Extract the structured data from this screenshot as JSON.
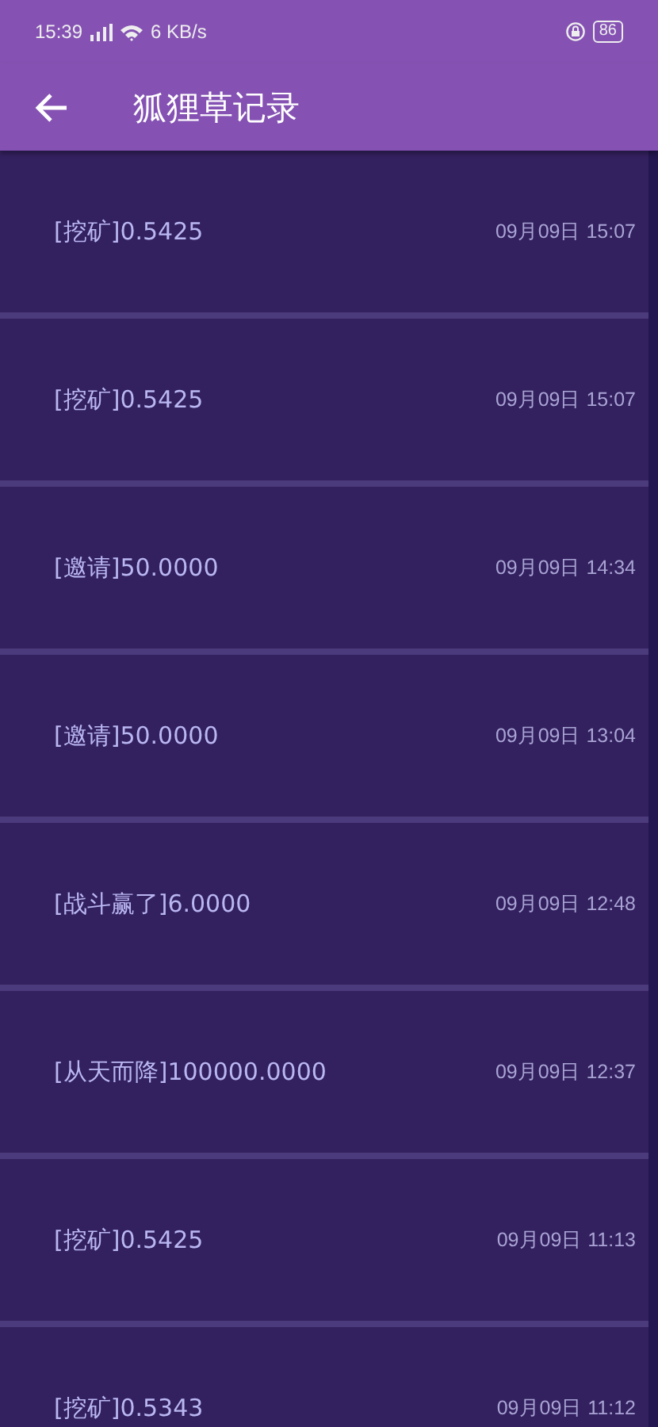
{
  "status_bar": {
    "time": "15:39",
    "speed": "6 KB/s",
    "battery": "86"
  },
  "app_bar": {
    "title": "狐狸草记录"
  },
  "records": [
    {
      "label": "[挖矿]0.5425",
      "time": "09月09日 15:07"
    },
    {
      "label": "[挖矿]0.5425",
      "time": "09月09日 15:07"
    },
    {
      "label": "[邀请]50.0000",
      "time": "09月09日 14:34"
    },
    {
      "label": "[邀请]50.0000",
      "time": "09月09日 13:04"
    },
    {
      "label": "[战斗赢了]6.0000",
      "time": "09月09日 12:48"
    },
    {
      "label": "[从天而降]100000.0000",
      "time": "09月09日 12:37"
    },
    {
      "label": "[挖矿]0.5425",
      "time": "09月09日 11:13"
    },
    {
      "label": "[挖矿]0.5343",
      "time": "09月09日 11:12"
    }
  ]
}
